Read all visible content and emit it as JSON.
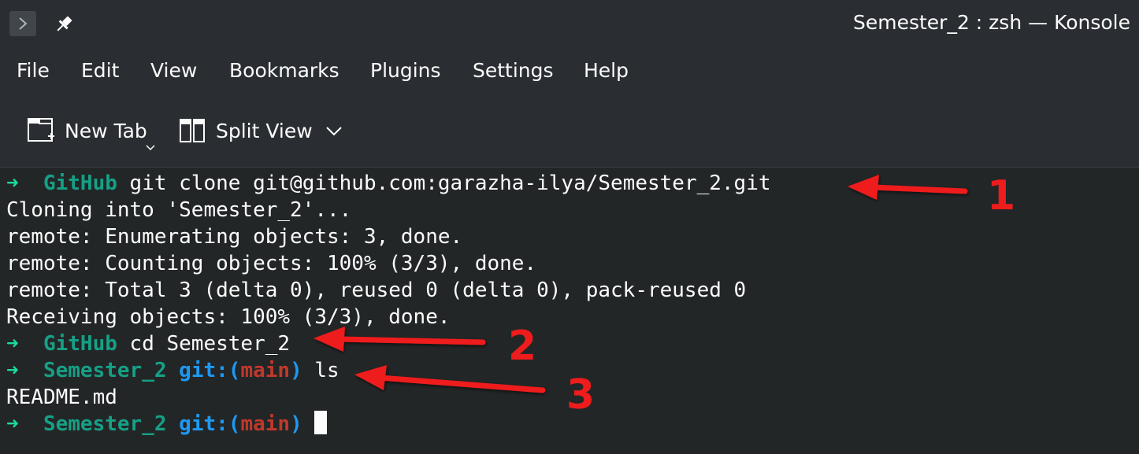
{
  "window": {
    "title": "Semester_2 : zsh — Konsole"
  },
  "menu": [
    "File",
    "Edit",
    "View",
    "Bookmarks",
    "Plugins",
    "Settings",
    "Help"
  ],
  "toolbar": {
    "new_tab": "New Tab",
    "split_view": "Split View"
  },
  "terminal": {
    "prompt_arrow": "➜",
    "lines": {
      "l1_dir": "GitHub",
      "l1_cmd": " git clone git@github.com:garazha-ilya/Semester_2.git",
      "l2": "Cloning into 'Semester_2'...",
      "l3": "remote: Enumerating objects: 3, done.",
      "l4": "remote: Counting objects: 100% (3/3), done.",
      "l5": "remote: Total 3 (delta 0), reused 0 (delta 0), pack-reused 0",
      "l6": "Receiving objects: 100% (3/3), done.",
      "l7_dir": "GitHub",
      "l7_cmd": " cd Semester_2",
      "l8_dir": "Semester_2",
      "l8_git": "git:(",
      "l8_branch": "main",
      "l8_git_close": ")",
      "l8_cmd": " ls",
      "l9": "README.md",
      "l10_dir": "Semester_2",
      "l10_git": "git:(",
      "l10_branch": "main",
      "l10_git_close": ")"
    }
  },
  "annotations": [
    "1",
    "2",
    "3"
  ],
  "colors": {
    "accent_red": "#ee1c1c",
    "prompt_green": "#1cdc9a",
    "dir_teal": "#16a085",
    "git_blue": "#1d99f3",
    "branch_red": "#c0392b"
  }
}
